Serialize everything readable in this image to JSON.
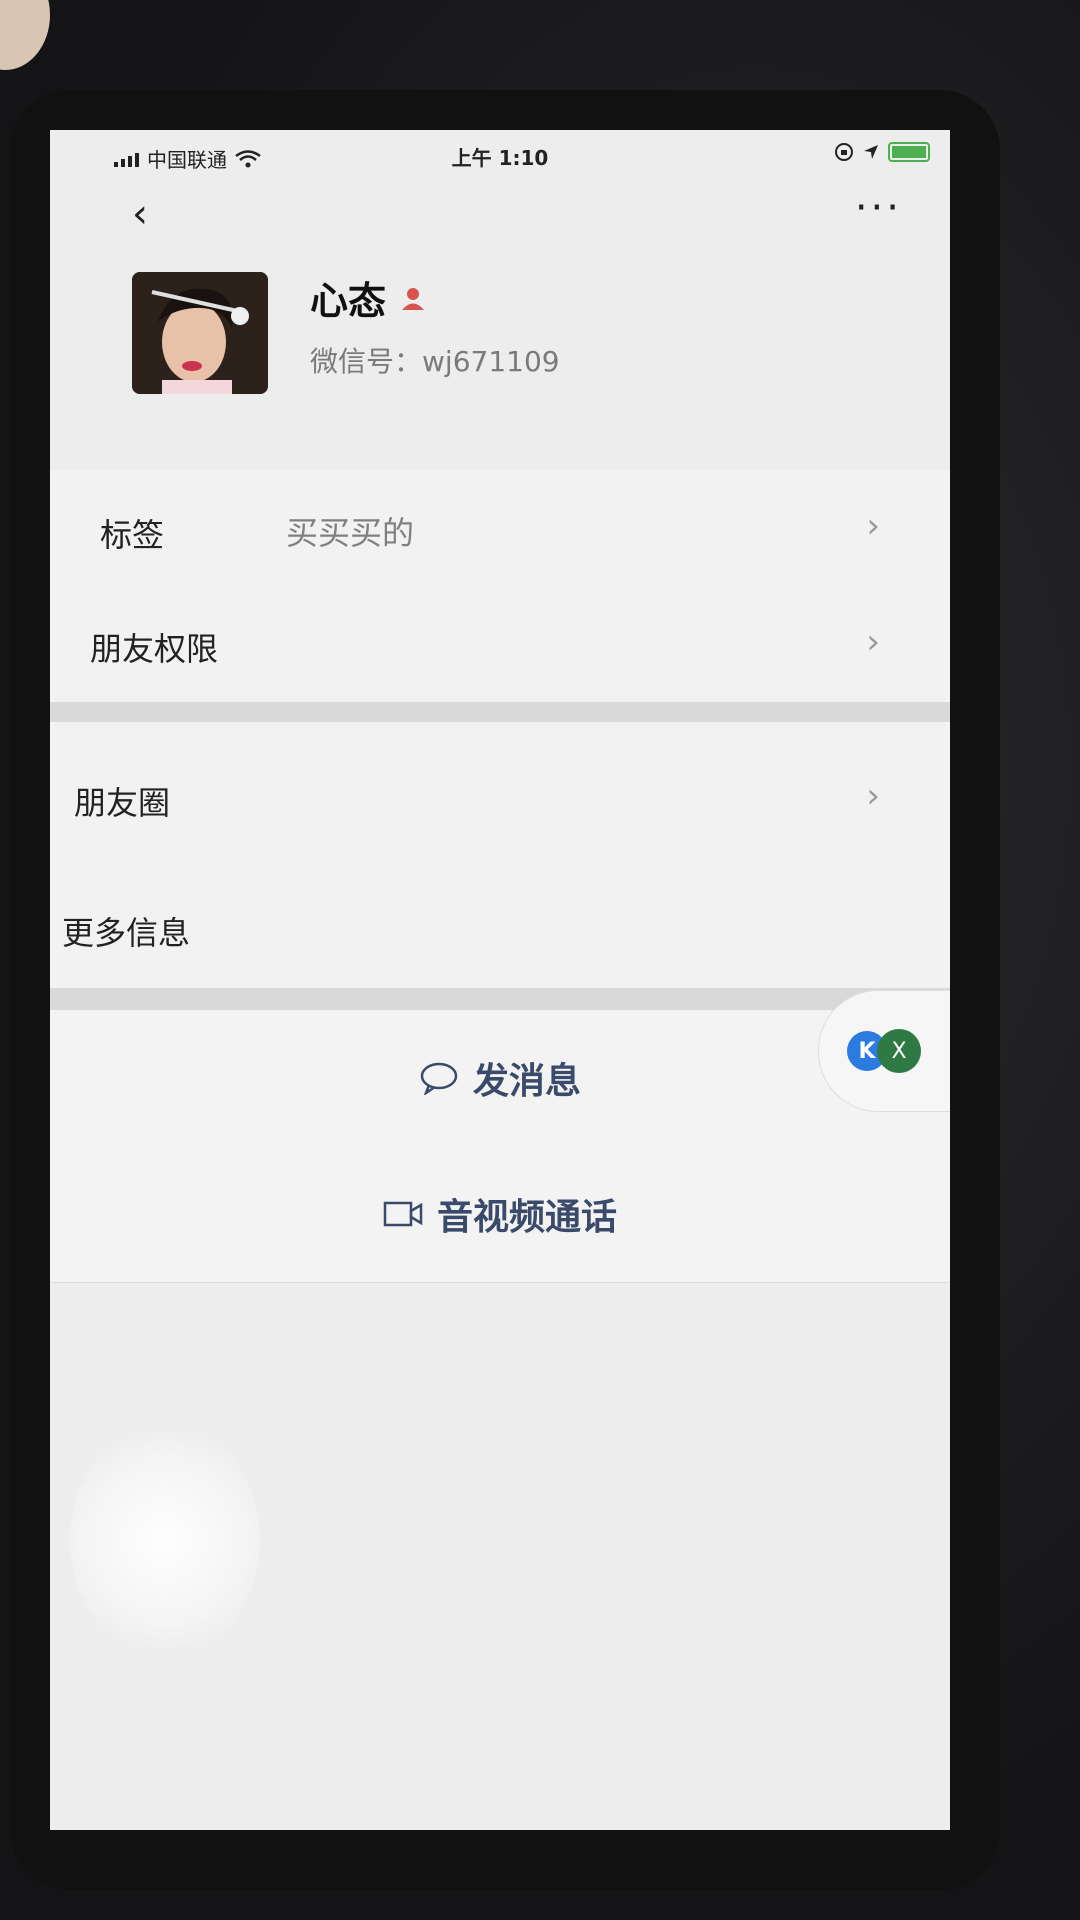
{
  "status_bar": {
    "carrier": "中国联通",
    "time": "上午 1:10"
  },
  "profile": {
    "name": "心态",
    "wechat_id_label": "微信号：",
    "wechat_id": "wj671109"
  },
  "rows": {
    "tags": {
      "label": "标签",
      "value": "买买买的"
    },
    "friend_permissions": {
      "label": "朋友权限"
    },
    "moments": {
      "label": "朋友圈"
    },
    "more_info": {
      "label": "更多信息"
    }
  },
  "actions": {
    "send_message": "发消息",
    "video_call": "音视频通话"
  },
  "floating": {
    "left_badge": "K",
    "right_badge": "X"
  },
  "colors": {
    "action_text": "#3a4a6a",
    "person_icon": "#d9534f",
    "battery": "#4caf50"
  },
  "icons": [
    "back-icon",
    "more-icon",
    "person-icon",
    "chevron-right-icon",
    "chat-bubble-icon",
    "video-camera-icon",
    "wifi-icon",
    "signal-icon",
    "battery-icon",
    "location-icon",
    "lock-rotation-icon"
  ]
}
